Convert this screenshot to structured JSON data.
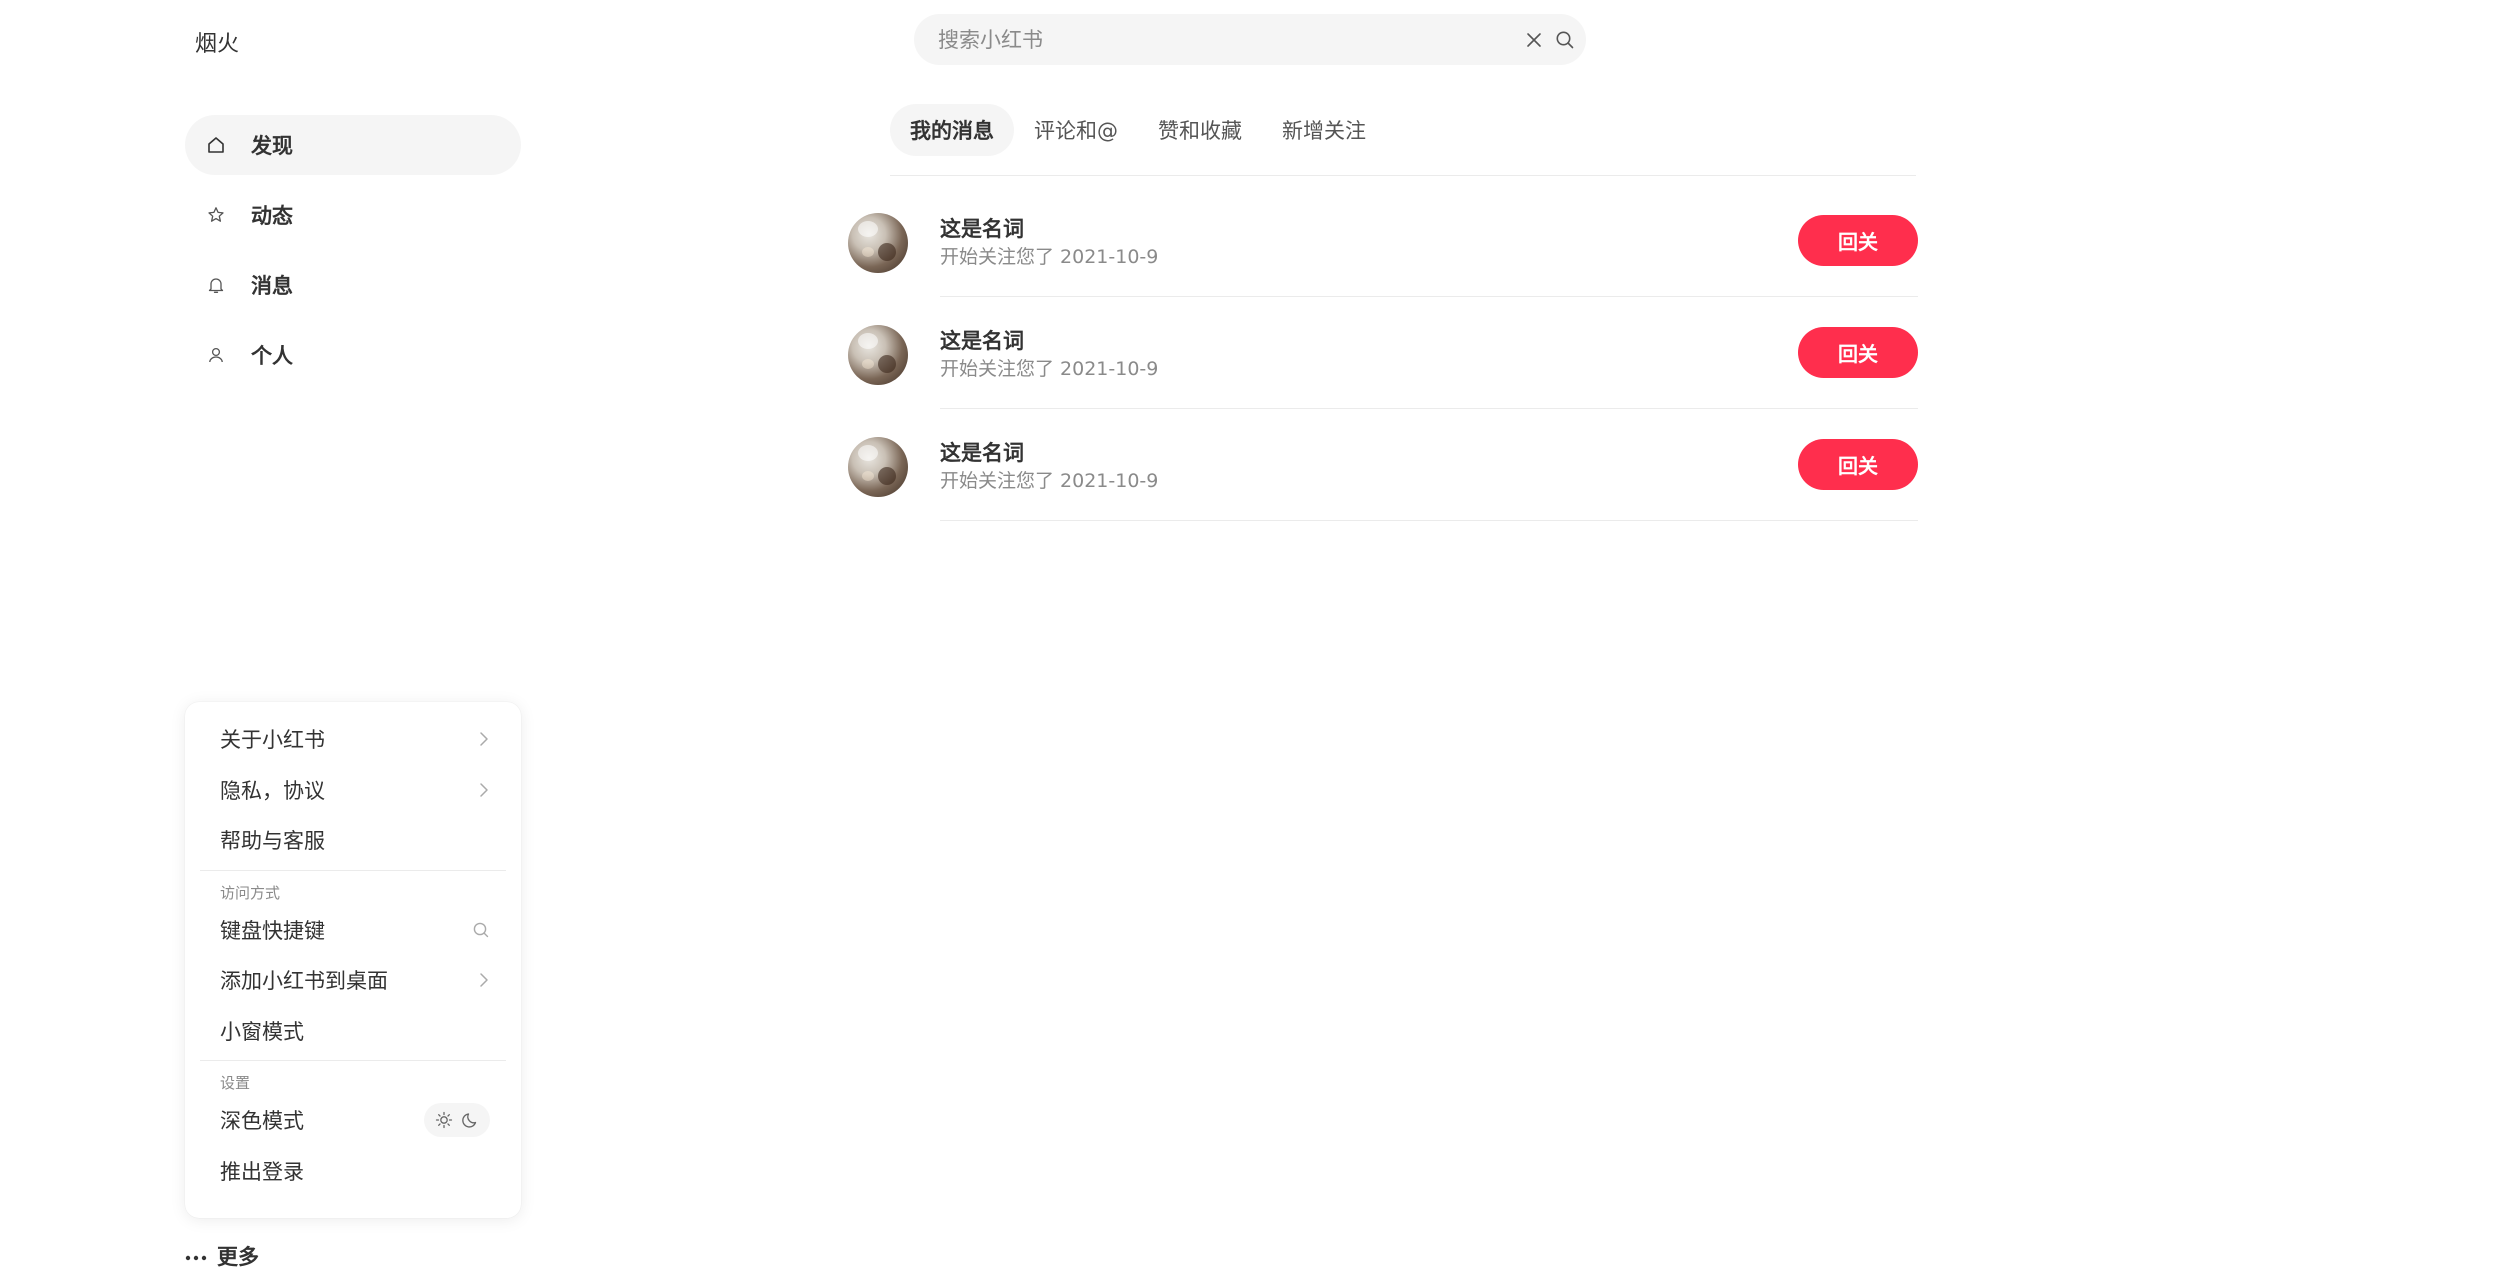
{
  "app": {
    "brand": "烟火"
  },
  "search": {
    "placeholder": "搜索小红书",
    "value": "",
    "clear_icon": "close-icon",
    "search_icon": "search-icon"
  },
  "sidebar": {
    "items": [
      {
        "label": "发现",
        "icon": "home-icon",
        "active": true
      },
      {
        "label": "动态",
        "icon": "star-icon",
        "active": false
      },
      {
        "label": "消息",
        "icon": "bell-icon",
        "active": false
      },
      {
        "label": "个人",
        "icon": "user-icon",
        "active": false
      }
    ]
  },
  "more_menu": {
    "items_top": [
      {
        "label": "关于小红书",
        "trail": "chevron-right-icon"
      },
      {
        "label": "隐私，协议",
        "trail": "chevron-right-icon"
      },
      {
        "label": "帮助与客服",
        "trail": ""
      }
    ],
    "section_access": "访问方式",
    "items_access": [
      {
        "label": "键盘快捷键",
        "trail": "search-icon"
      },
      {
        "label": "添加小红书到桌面",
        "trail": "chevron-right-icon"
      },
      {
        "label": "小窗模式",
        "trail": ""
      }
    ],
    "section_settings": "设置",
    "dark_mode_label": "深色模式",
    "logout_label": "推出登录",
    "theme_icons": [
      "sun-icon",
      "moon-icon"
    ]
  },
  "more_button": {
    "label": "更多",
    "icon": "ellipsis-icon"
  },
  "tabs": [
    {
      "label": "我的消息",
      "active": true
    },
    {
      "label": "评论和@",
      "active": false
    },
    {
      "label": "赞和收藏",
      "active": false
    },
    {
      "label": "新增关注",
      "active": false
    }
  ],
  "notifications": [
    {
      "name": "这是名词",
      "desc": "开始关注您了 2021-10-9",
      "action": "回关"
    },
    {
      "name": "这是名词",
      "desc": "开始关注您了 2021-10-9",
      "action": "回关"
    },
    {
      "name": "这是名词",
      "desc": "开始关注您了 2021-10-9",
      "action": "回关"
    }
  ],
  "colors": {
    "accent": "#ff2e4d",
    "active_bg": "#f5f5f5",
    "text": "#333333",
    "muted": "#8a8a8a",
    "divider": "#ebebeb"
  }
}
